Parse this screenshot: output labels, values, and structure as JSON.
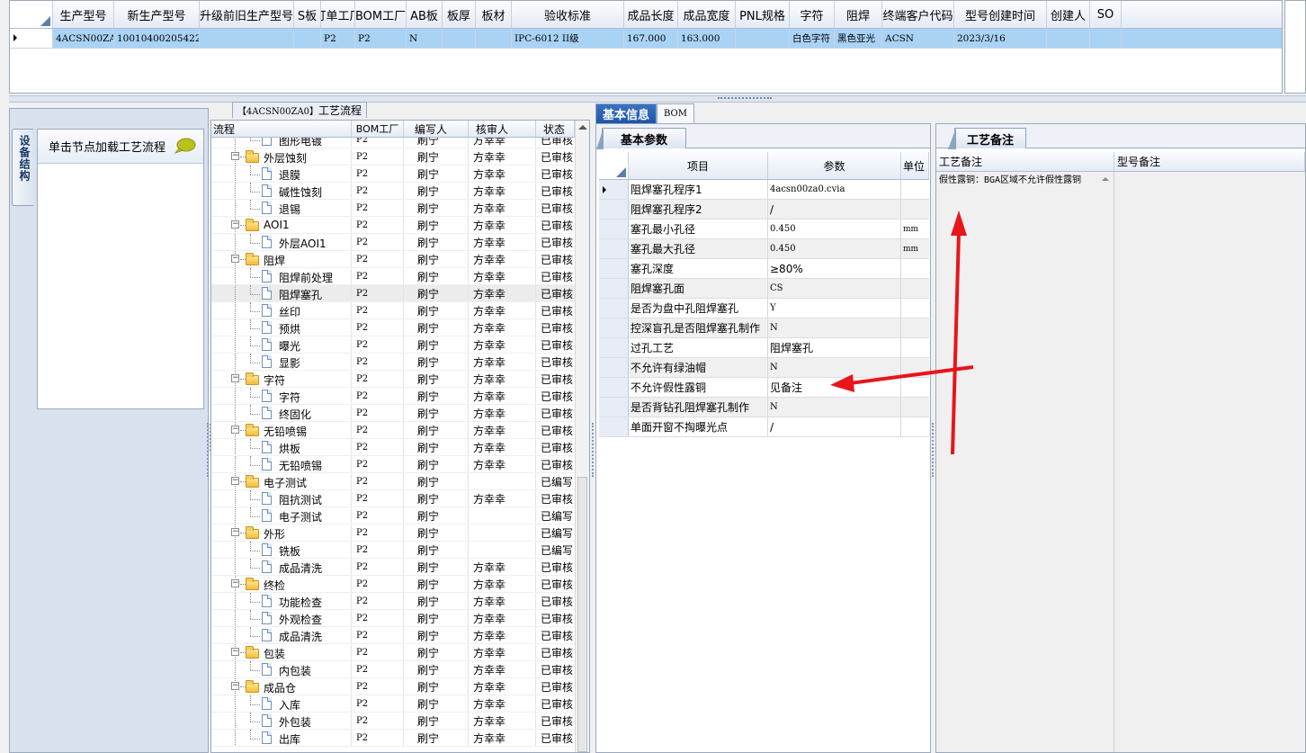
{
  "top_grid": {
    "columns": [
      "生产型号",
      "新生产型号",
      "升级前旧生产型号",
      "S板",
      "订单工厂",
      "BOM工厂",
      "AB板",
      "板厚",
      "板材",
      "验收标准",
      "成品长度",
      "成品宽度",
      "PNL规格",
      "字符",
      "阻焊",
      "终端客户代码",
      "型号创建时间",
      "创建人",
      "SO"
    ],
    "row": [
      "4ACSN00ZA0",
      "10010400205422",
      "",
      "",
      "P2",
      "P2",
      "N",
      "",
      "",
      "IPC-6012 II级",
      "167.000",
      "163.000",
      "",
      "白色字符",
      "黑色亚光",
      "ACSN",
      "2023/3/16",
      "",
      ""
    ]
  },
  "sidebar": {
    "tab_label": "设备结构",
    "header_text": "单击节点加载工艺流程",
    "icon": "speech-bubble-icon"
  },
  "tree": {
    "title_code": "【4ACSN00ZA0】",
    "title_text": "工艺流程",
    "columns": [
      "流程",
      "BOM工厂",
      "编写人",
      "核审人",
      "状态"
    ],
    "rows": [
      {
        "level": 2,
        "type": "doc",
        "name": "图形电镀",
        "bom": "P2",
        "writer": "刷宁",
        "reviewer": "方幸幸",
        "status": "已审核"
      },
      {
        "level": 1,
        "type": "folder",
        "name": "外层蚀刻",
        "bom": "P2",
        "writer": "刷宁",
        "reviewer": "方幸幸",
        "status": "已审核"
      },
      {
        "level": 2,
        "type": "doc",
        "name": "退膜",
        "bom": "P2",
        "writer": "刷宁",
        "reviewer": "方幸幸",
        "status": "已审核"
      },
      {
        "level": 2,
        "type": "doc",
        "name": "碱性蚀刻",
        "bom": "P2",
        "writer": "刷宁",
        "reviewer": "方幸幸",
        "status": "已审核"
      },
      {
        "level": 2,
        "type": "doc",
        "name": "退锡",
        "bom": "P2",
        "writer": "刷宁",
        "reviewer": "方幸幸",
        "status": "已审核"
      },
      {
        "level": 1,
        "type": "folder",
        "name": "AOI1",
        "bom": "P2",
        "writer": "刷宁",
        "reviewer": "方幸幸",
        "status": "已审核"
      },
      {
        "level": 2,
        "type": "doc",
        "name": "外层AOI1",
        "bom": "P2",
        "writer": "刷宁",
        "reviewer": "方幸幸",
        "status": "已审核"
      },
      {
        "level": 1,
        "type": "folder",
        "name": "阻焊",
        "bom": "P2",
        "writer": "刷宁",
        "reviewer": "方幸幸",
        "status": "已审核"
      },
      {
        "level": 2,
        "type": "doc",
        "name": "阻焊前处理",
        "bom": "P2",
        "writer": "刷宁",
        "reviewer": "方幸幸",
        "status": "已审核"
      },
      {
        "level": 2,
        "type": "doc",
        "name": "阻焊塞孔",
        "bom": "P2",
        "writer": "刷宁",
        "reviewer": "方幸幸",
        "status": "已审核",
        "selected": true
      },
      {
        "level": 2,
        "type": "doc",
        "name": "丝印",
        "bom": "P2",
        "writer": "刷宁",
        "reviewer": "方幸幸",
        "status": "已审核"
      },
      {
        "level": 2,
        "type": "doc",
        "name": "预烘",
        "bom": "P2",
        "writer": "刷宁",
        "reviewer": "方幸幸",
        "status": "已审核"
      },
      {
        "level": 2,
        "type": "doc",
        "name": "曝光",
        "bom": "P2",
        "writer": "刷宁",
        "reviewer": "方幸幸",
        "status": "已审核"
      },
      {
        "level": 2,
        "type": "doc",
        "name": "显影",
        "bom": "P2",
        "writer": "刷宁",
        "reviewer": "方幸幸",
        "status": "已审核"
      },
      {
        "level": 1,
        "type": "folder",
        "name": "字符",
        "bom": "P2",
        "writer": "刷宁",
        "reviewer": "方幸幸",
        "status": "已审核"
      },
      {
        "level": 2,
        "type": "doc",
        "name": "字符",
        "bom": "P2",
        "writer": "刷宁",
        "reviewer": "方幸幸",
        "status": "已审核"
      },
      {
        "level": 2,
        "type": "doc",
        "name": "终固化",
        "bom": "P2",
        "writer": "刷宁",
        "reviewer": "方幸幸",
        "status": "已审核"
      },
      {
        "level": 1,
        "type": "folder",
        "name": "无铅喷锡",
        "bom": "P2",
        "writer": "刷宁",
        "reviewer": "方幸幸",
        "status": "已审核"
      },
      {
        "level": 2,
        "type": "doc",
        "name": "烘板",
        "bom": "P2",
        "writer": "刷宁",
        "reviewer": "方幸幸",
        "status": "已审核"
      },
      {
        "level": 2,
        "type": "doc",
        "name": "无铅喷锡",
        "bom": "P2",
        "writer": "刷宁",
        "reviewer": "方幸幸",
        "status": "已审核"
      },
      {
        "level": 1,
        "type": "folder",
        "name": "电子测试",
        "bom": "P2",
        "writer": "刷宁",
        "reviewer": "",
        "status": "已编写"
      },
      {
        "level": 2,
        "type": "doc",
        "name": "阻抗测试",
        "bom": "P2",
        "writer": "刷宁",
        "reviewer": "方幸幸",
        "status": "已审核"
      },
      {
        "level": 2,
        "type": "doc",
        "name": "电子测试",
        "bom": "P2",
        "writer": "刷宁",
        "reviewer": "",
        "status": "已编写"
      },
      {
        "level": 1,
        "type": "folder",
        "name": "外形",
        "bom": "P2",
        "writer": "刷宁",
        "reviewer": "",
        "status": "已编写"
      },
      {
        "level": 2,
        "type": "doc",
        "name": "铣板",
        "bom": "P2",
        "writer": "刷宁",
        "reviewer": "",
        "status": "已编写"
      },
      {
        "level": 2,
        "type": "doc",
        "name": "成品清洗",
        "bom": "P2",
        "writer": "刷宁",
        "reviewer": "方幸幸",
        "status": "已审核"
      },
      {
        "level": 1,
        "type": "folder",
        "name": "终检",
        "bom": "P2",
        "writer": "刷宁",
        "reviewer": "方幸幸",
        "status": "已审核"
      },
      {
        "level": 2,
        "type": "doc",
        "name": "功能检查",
        "bom": "P2",
        "writer": "刷宁",
        "reviewer": "方幸幸",
        "status": "已审核"
      },
      {
        "level": 2,
        "type": "doc",
        "name": "外观检查",
        "bom": "P2",
        "writer": "刷宁",
        "reviewer": "方幸幸",
        "status": "已审核"
      },
      {
        "level": 2,
        "type": "doc",
        "name": "成品清洗",
        "bom": "P2",
        "writer": "刷宁",
        "reviewer": "方幸幸",
        "status": "已审核"
      },
      {
        "level": 1,
        "type": "folder",
        "name": "包装",
        "bom": "P2",
        "writer": "刷宁",
        "reviewer": "方幸幸",
        "status": "已审核"
      },
      {
        "level": 2,
        "type": "doc",
        "name": "内包装",
        "bom": "P2",
        "writer": "刷宁",
        "reviewer": "方幸幸",
        "status": "已审核"
      },
      {
        "level": 1,
        "type": "folder",
        "name": "成品仓",
        "bom": "P2",
        "writer": "刷宁",
        "reviewer": "方幸幸",
        "status": "已审核"
      },
      {
        "level": 2,
        "type": "doc",
        "name": "入库",
        "bom": "P2",
        "writer": "刷宁",
        "reviewer": "方幸幸",
        "status": "已审核"
      },
      {
        "level": 2,
        "type": "doc",
        "name": "外包装",
        "bom": "P2",
        "writer": "刷宁",
        "reviewer": "方幸幸",
        "status": "已审核"
      },
      {
        "level": 2,
        "type": "doc",
        "name": "出库",
        "bom": "P2",
        "writer": "刷宁",
        "reviewer": "方幸幸",
        "status": "已审核"
      }
    ]
  },
  "mid": {
    "tabs": [
      "基本信息",
      "BOM"
    ],
    "subtab": "基本参数",
    "columns": [
      "项目",
      "参数",
      "单位"
    ],
    "rows": [
      {
        "item": "阻焊塞孔程序1",
        "param": "4acsn00za0.cvia",
        "unit": "",
        "mono": true
      },
      {
        "item": "阻焊塞孔程序2",
        "param": "/",
        "unit": ""
      },
      {
        "item": "塞孔最小孔径",
        "param": "0.450",
        "unit": "mm",
        "mono": true
      },
      {
        "item": "塞孔最大孔径",
        "param": "0.450",
        "unit": "mm",
        "mono": true
      },
      {
        "item": "塞孔深度",
        "param": "≥80%",
        "unit": ""
      },
      {
        "item": "阻焊塞孔面",
        "param": "CS",
        "unit": "",
        "mono": true
      },
      {
        "item": "是否为盘中孔阻焊塞孔",
        "param": "Y",
        "unit": "",
        "mono": true
      },
      {
        "item": "控深盲孔是否阻焊塞孔制作",
        "param": "N",
        "unit": "",
        "mono": true
      },
      {
        "item": "过孔工艺",
        "param": "阻焊塞孔",
        "unit": ""
      },
      {
        "item": "不允许有绿油帽",
        "param": "N",
        "unit": "",
        "mono": true
      },
      {
        "item": "不允许假性露铜",
        "param": "见备注",
        "unit": ""
      },
      {
        "item": "是否背钻孔阻焊塞孔制作",
        "param": "N",
        "unit": "",
        "mono": true
      },
      {
        "item": "单面开窗不掏曝光点",
        "param": "/",
        "unit": ""
      }
    ]
  },
  "right": {
    "subtab": "工艺备注",
    "columns": [
      "工艺备注",
      "型号备注"
    ],
    "note_text": "假性露铜：BGA区域不允许假性露铜"
  },
  "colors": {
    "annotation_arrow": "#e8151b",
    "row_selected": "#a9d3f5",
    "tab_active": "#2a62b2"
  }
}
